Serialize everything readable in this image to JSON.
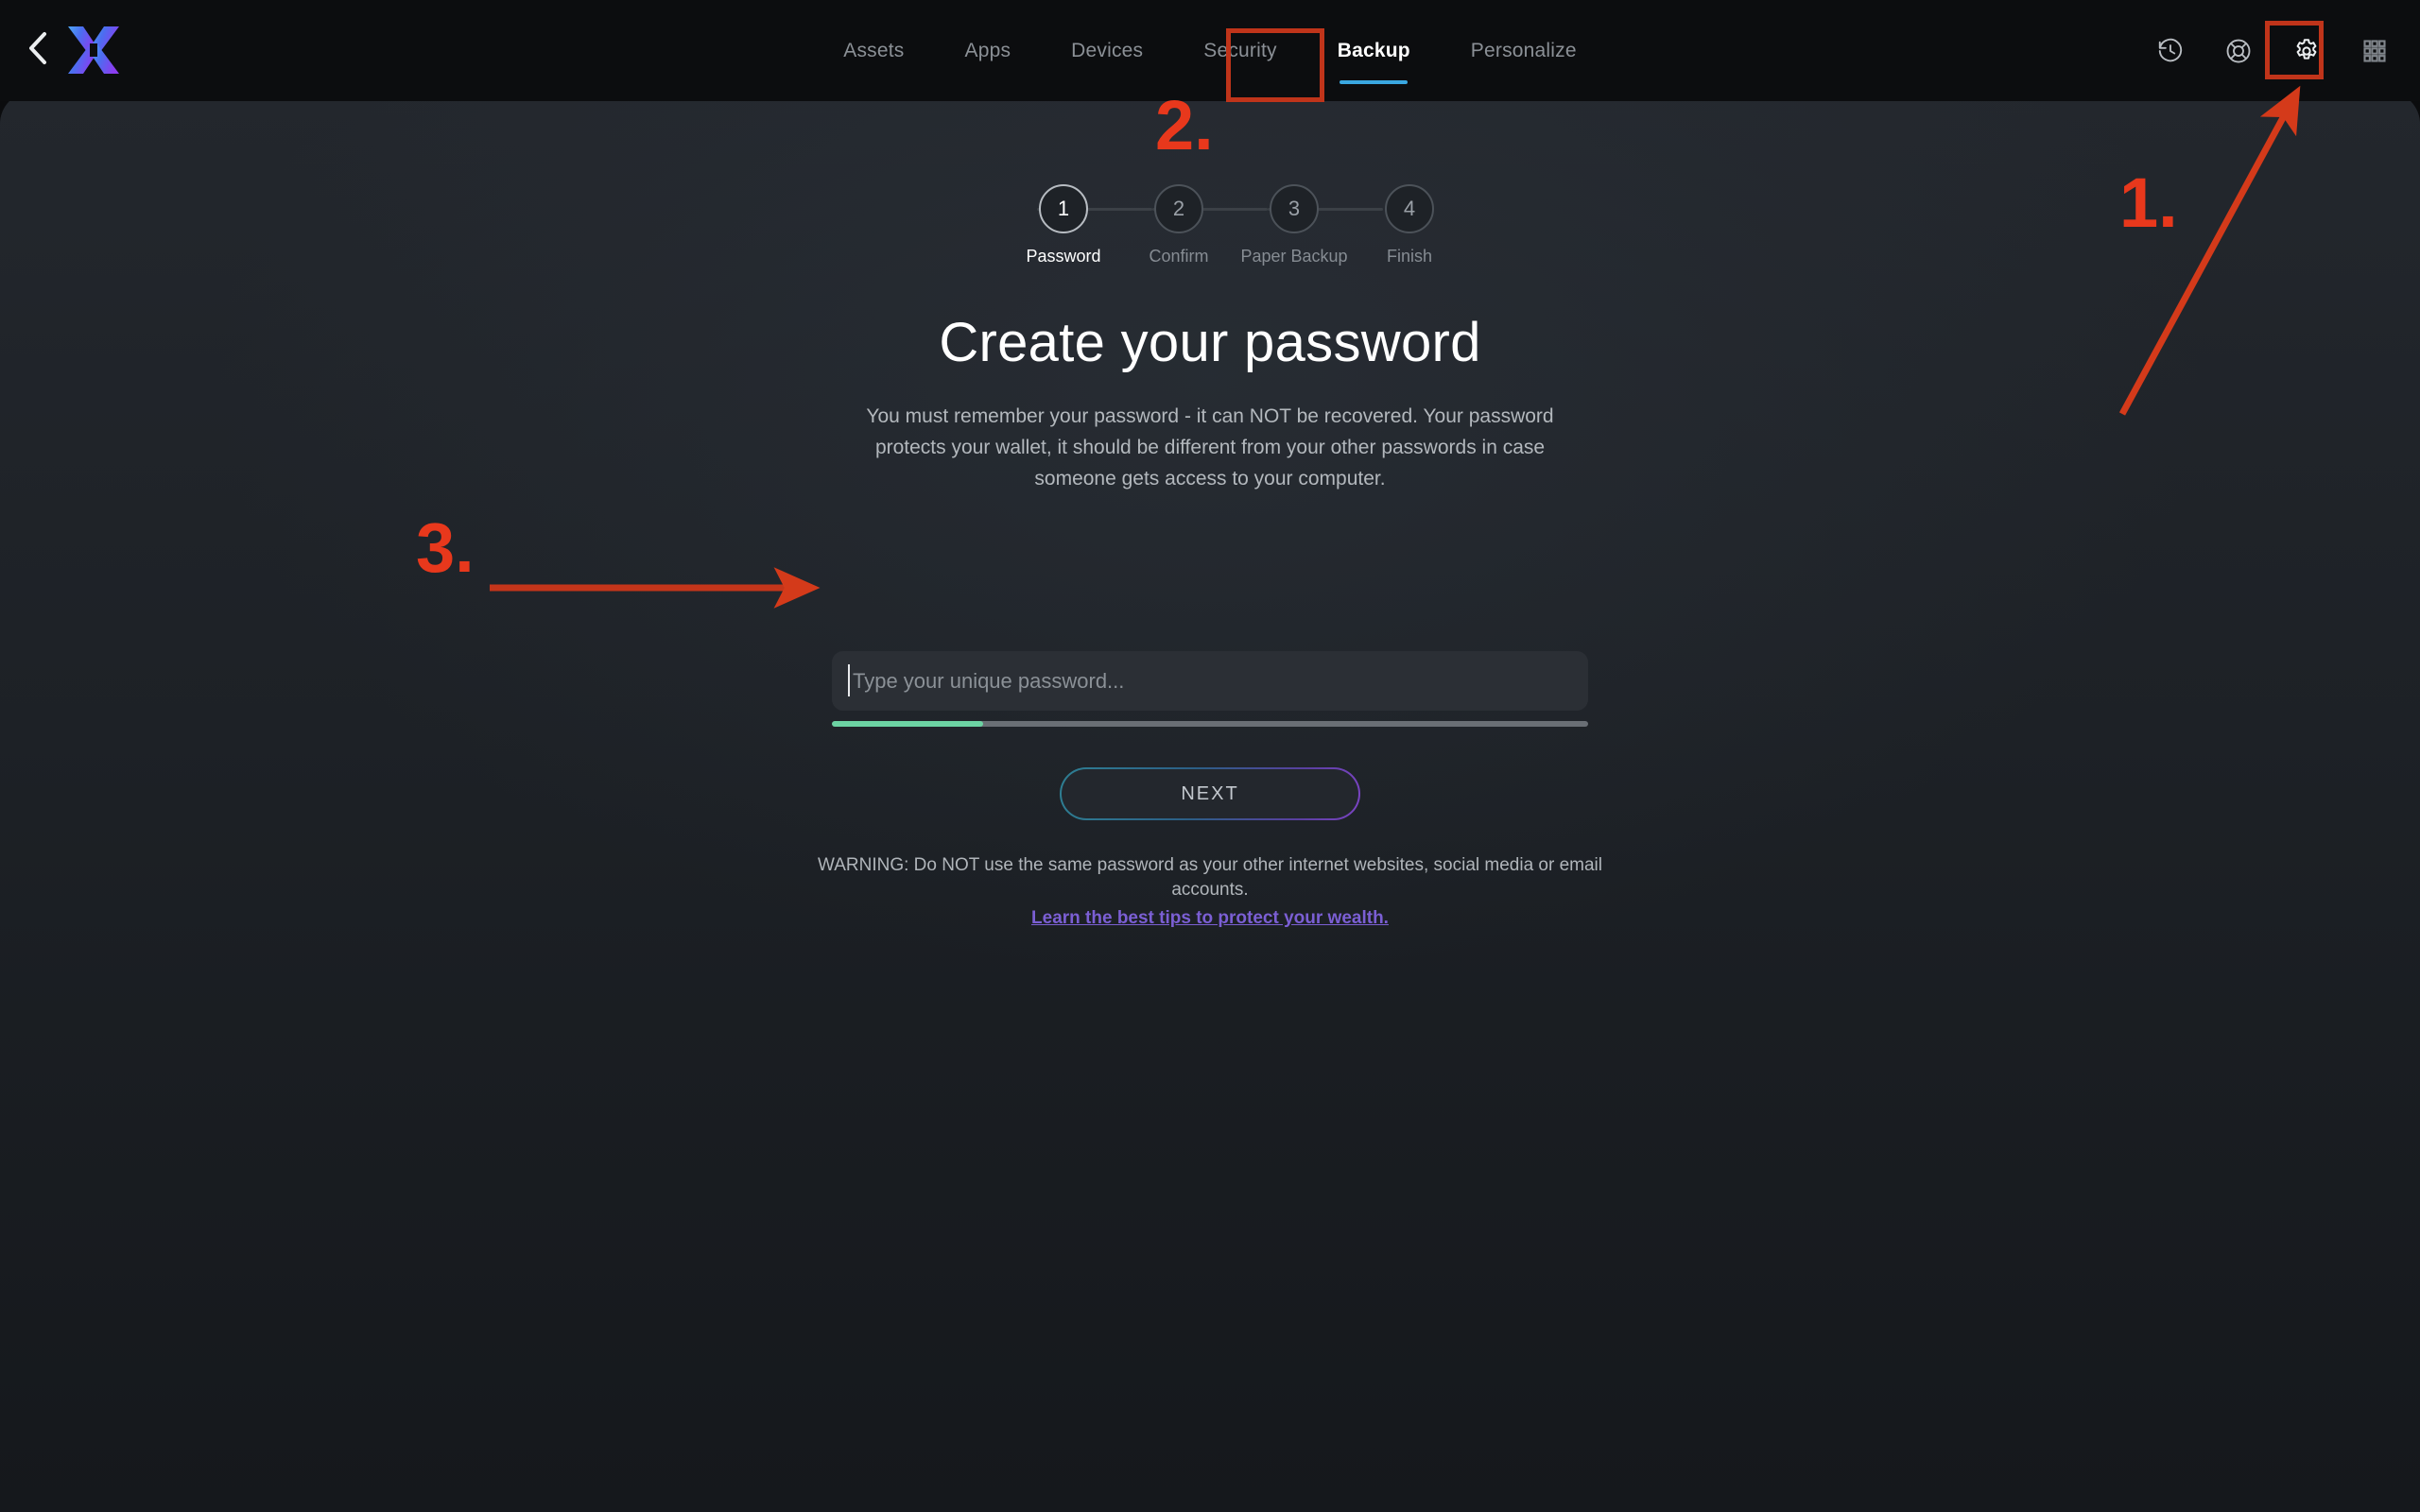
{
  "header": {
    "back_icon": "chevron-left-icon",
    "logo_icon": "exodus-x-logo",
    "nav_items": [
      {
        "label": "Assets",
        "active": false
      },
      {
        "label": "Apps",
        "active": false
      },
      {
        "label": "Devices",
        "active": false
      },
      {
        "label": "Security",
        "active": false
      },
      {
        "label": "Backup",
        "active": true
      },
      {
        "label": "Personalize",
        "active": false
      }
    ],
    "icons": [
      {
        "name": "history-icon",
        "title": "History"
      },
      {
        "name": "lifebuoy-help-icon",
        "title": "Help"
      },
      {
        "name": "gear-settings-icon",
        "title": "Settings"
      },
      {
        "name": "grid-apps-icon",
        "title": "Apps"
      }
    ],
    "active_underline_color": "#3aa7e0"
  },
  "stepper": {
    "steps": [
      {
        "number": "1",
        "label": "Password",
        "active": true
      },
      {
        "number": "2",
        "label": "Confirm",
        "active": false
      },
      {
        "number": "3",
        "label": "Paper Backup",
        "active": false
      },
      {
        "number": "4",
        "label": "Finish",
        "active": false
      }
    ]
  },
  "main": {
    "title": "Create your password",
    "description": "You must remember your password - it can NOT be recovered. Your password protects your wallet, it should be different from your other passwords in case someone gets access to your computer.",
    "password_field": {
      "value": "",
      "placeholder": "Type your unique password...",
      "strength_percent": 20,
      "strength_color": "#6cd3a3"
    },
    "next_label": "NEXT",
    "warning_text": "WARNING: Do NOT use the same password as your other internet websites, social media or email accounts.",
    "warning_link": "Learn the best tips to protect your wealth.",
    "link_color": "#7b5fd4"
  },
  "annotations": {
    "color": "#e8381c",
    "items": [
      {
        "label": "1.",
        "target": "gear-settings-icon"
      },
      {
        "label": "2.",
        "target": "nav-backup-tab"
      },
      {
        "label": "3.",
        "target": "password-input"
      }
    ]
  }
}
